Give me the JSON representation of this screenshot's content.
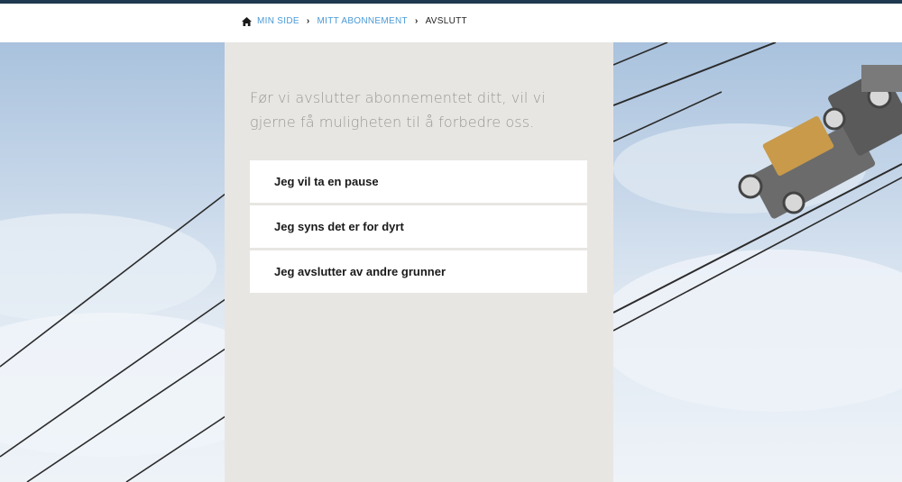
{
  "breadcrumb": {
    "home_icon": "home-icon",
    "items": [
      "MIN SIDE",
      "MITT ABONNEMENT"
    ],
    "current": "AVSLUTT",
    "link_color": "#4a9ad6"
  },
  "panel": {
    "intro_text": "Før vi avslutter abonnementet ditt, vil vi gjerne få muligheten til å forbedre oss.",
    "options": [
      "Jeg vil ta en pause",
      "Jeg syns det er for dyrt",
      "Jeg avslutter av andre grunner"
    ]
  },
  "colors": {
    "top_bar": "#1f3a50",
    "panel_bg": "#e8e6e3",
    "option_bg": "#ffffff"
  }
}
